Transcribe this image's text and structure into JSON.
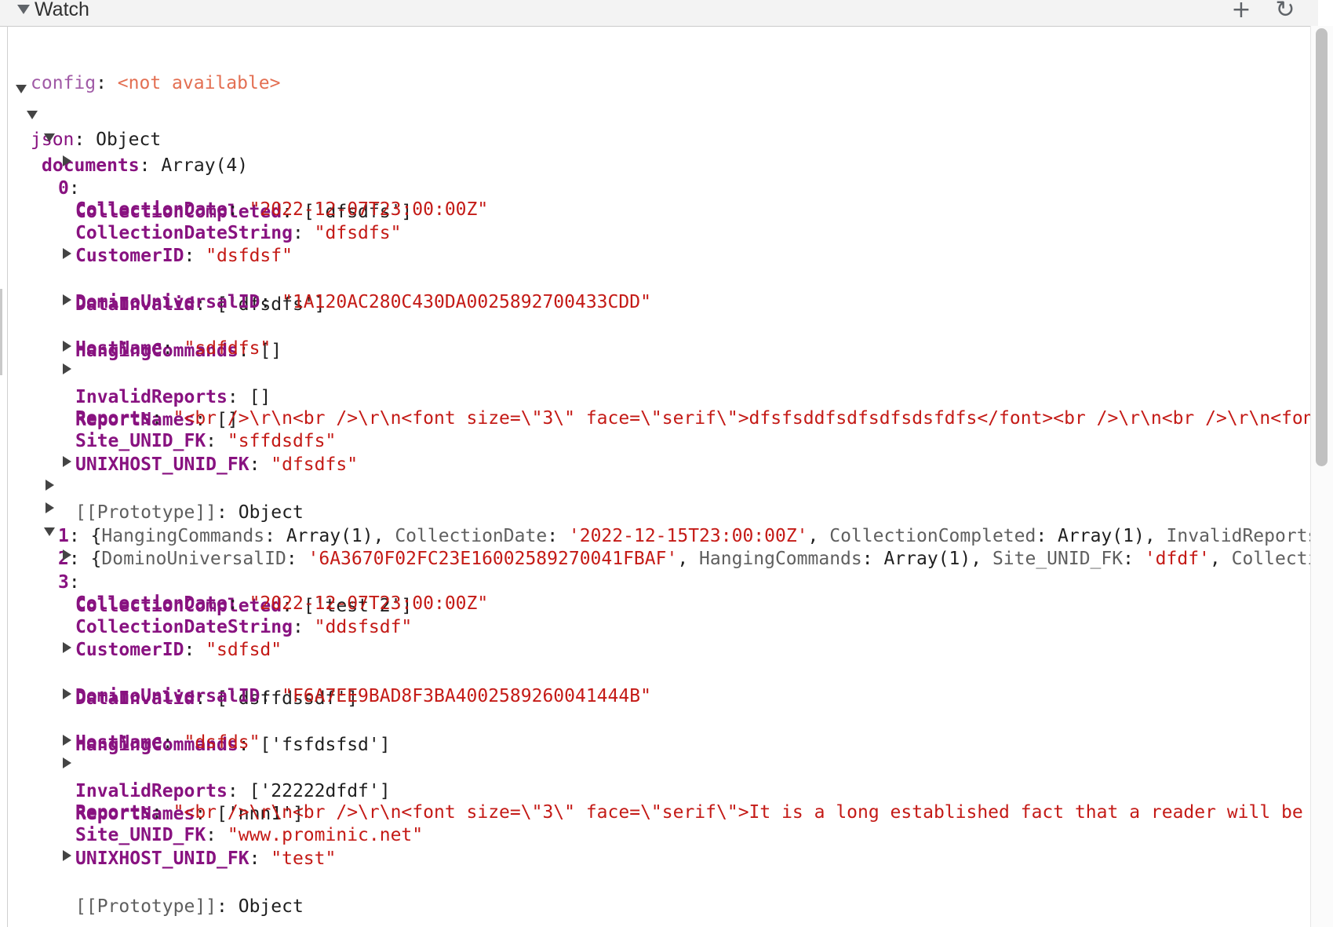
{
  "panel": {
    "title": "Watch",
    "add_glyph": "+",
    "refresh_glyph": "↻",
    "add_icon": "plus-icon",
    "refresh_icon": "refresh-icon"
  },
  "watch": {
    "config_name": "config",
    "config_value": "<not available>",
    "json_name": "json",
    "json_type": "Object",
    "documents_name": "documents",
    "documents_type": "Array(4)",
    "doc0": {
      "index": "0",
      "collection_completed": "['dfsdfs']",
      "collection_date": "\"2022-12-07T23:00:00Z\"",
      "collection_date_string": "\"dfsdfs\"",
      "customer_id": "\"dsfdsf\"",
      "data_invalid": "['dfsdfs']",
      "domino_universal_id": "\"1A120AC280C430DA0025892700433CDD\"",
      "hanging_commands": "[]",
      "host_name": "\"sdfdfs\"",
      "invalid_reports": "[]",
      "report_names": "[]",
      "reports": "\"<br />\\r\\n<br />\\r\\n<font size=\\\"3\\\" face=\\\"serif\\\">dfsfsddfsdfsdfsdsfdfs</font><br />\\r\\n<br />\\r\\n<font si",
      "site_unid_fk": "\"sffdsdfs\"",
      "unixhost_unid_fk": "\"dfsdfs\"",
      "prototype": "Object"
    },
    "doc1": {
      "index": "1",
      "preview": [
        {
          "k": "HangingCommands",
          "v": "Array(1)",
          "t": "d"
        },
        {
          "k": "CollectionDate",
          "v": "'2022-12-15T23:00:00Z'",
          "t": "s"
        },
        {
          "k": "CollectionCompleted",
          "v": "Array(1)",
          "t": "d"
        },
        {
          "k": "InvalidReports",
          "v": "Ar",
          "t": "d"
        }
      ]
    },
    "doc2": {
      "index": "2",
      "preview": [
        {
          "k": "DominoUniversalID",
          "v": "'6A3670F02FC23E16002589270041FBAF'",
          "t": "s"
        },
        {
          "k": "HangingCommands",
          "v": "Array(1)",
          "t": "d"
        },
        {
          "k": "Site_UNID_FK",
          "v": "'dfdf'",
          "t": "s"
        },
        {
          "k": "CollectionCo",
          "v": "",
          "t": "d"
        }
      ]
    },
    "doc3": {
      "index": "3",
      "collection_completed": "['test 2']",
      "collection_date": "\"2022-12-07T23:00:00Z\"",
      "collection_date_string": "\"ddsfsdf\"",
      "customer_id": "\"sdfsd\"",
      "data_invalid": "['dsffdssdf']",
      "domino_universal_id": "\"F6A7EE9BAD8F3BA4002589260041444B\"",
      "hanging_commands": "['fsfdsfsd']",
      "host_name": "\"dsfds\"",
      "invalid_reports": "['22222dfdf']",
      "report_names": "['nnn1']",
      "reports": "\"<br />\\r\\n<br />\\r\\n<font size=\\\"3\\\" face=\\\"serif\\\">It is a long established fact that a reader will be dist",
      "site_unid_fk": "\"www.prominic.net\"",
      "unixhost_unid_fk": "\"test\"",
      "prototype": "Object"
    }
  },
  "labels": {
    "collection_completed": "CollectionCompleted",
    "collection_date": "CollectionDate",
    "collection_date_string": "CollectionDateString",
    "customer_id": "CustomerID",
    "data_invalid": "DataInvalid",
    "domino_universal_id": "DominoUniversalID",
    "hanging_commands": "HangingCommands",
    "host_name": "HostName",
    "invalid_reports": "InvalidReports",
    "report_names": "ReportNames",
    "reports": "Reports",
    "site_unid_fk": "Site_UNID_FK",
    "unixhost_unid_fk": "UNIXHOST_UNID_FK",
    "prototype": "[[Prototype]]"
  },
  "colors": {
    "property_name": "#881280",
    "string_value": "#c41a16",
    "not_available": "#e36f52"
  }
}
